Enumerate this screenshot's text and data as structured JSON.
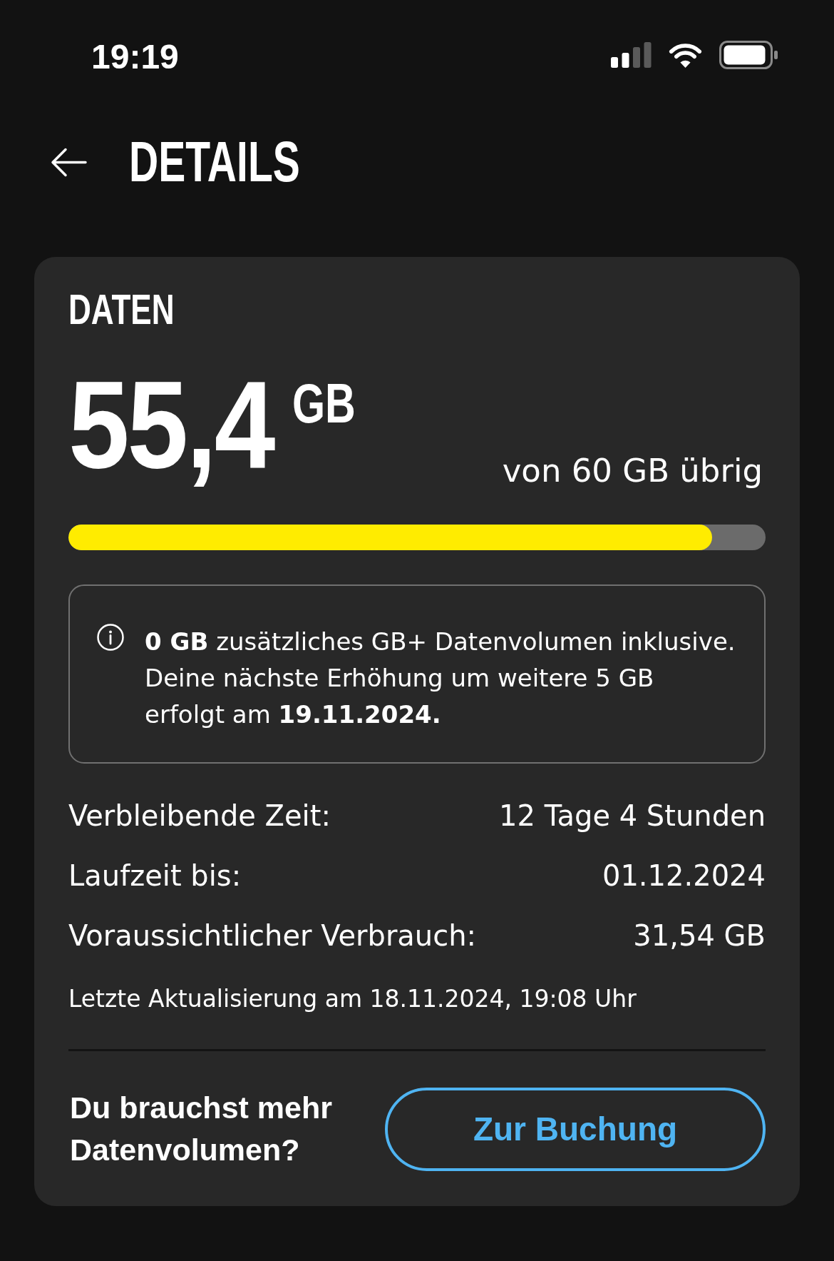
{
  "status_bar": {
    "time": "19:19"
  },
  "header": {
    "title": "DETAILS"
  },
  "data_card": {
    "title": "DATEN",
    "remaining": "55,4",
    "unit": "GB",
    "total": "von 60 GB übrig",
    "usage_bar": {
      "level": 0.923
    },
    "info": "**0 GB** zusätzliches GB+ Datenvolumen inklusive. Deine nächste Erhöhung um weitere 5 GB erfolgt am **19.11.2024.**",
    "details": [
      {
        "label": "Verbleibende Zeit:",
        "value": "12 Tage 4 Stunden"
      },
      {
        "label": "Laufzeit bis:",
        "value": "01.12.2024"
      },
      {
        "label": "Voraussichtlicher Verbrauch:",
        "value": "31,54 GB"
      }
    ],
    "last_update": "Letzte Aktualisierung am 18.11.2024, 19:08 Uhr",
    "upsell": {
      "question": "Du brauchst mehr Datenvolumen?",
      "button": "Zur Buchung"
    }
  }
}
